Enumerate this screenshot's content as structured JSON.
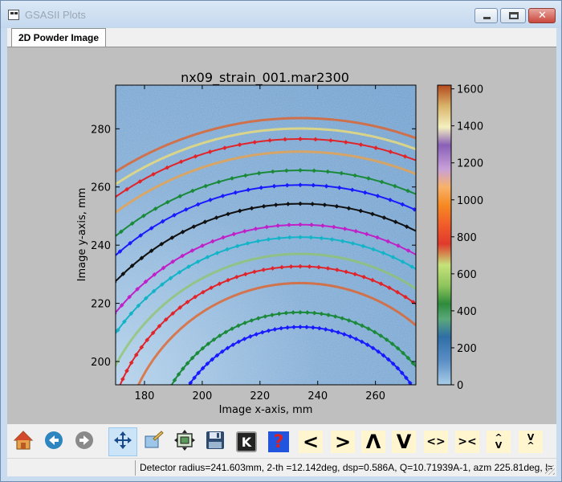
{
  "window": {
    "title": "GSASII Plots",
    "close_glyph": "✕"
  },
  "tabs": [
    {
      "label": "2D Powder Image",
      "active": true
    }
  ],
  "plot": {
    "title": "nx09_strain_001.mar2300",
    "xlabel": "Image x-axis, mm",
    "ylabel": "Image y-axis, mm",
    "xlim": [
      170,
      274
    ],
    "ylim": [
      192,
      295
    ],
    "x_ticks": [
      "180",
      "200",
      "220",
      "240",
      "260"
    ],
    "y_ticks": [
      "200",
      "220",
      "240",
      "260",
      "280"
    ],
    "colorbar": {
      "range": [
        0,
        1620
      ],
      "ticks": [
        "0",
        "200",
        "400",
        "600",
        "800",
        "1000",
        "1200",
        "1400",
        "1600"
      ]
    },
    "center": [
      145,
      157
    ],
    "rings": [
      {
        "r": 65,
        "color": "#1a1aff",
        "markers": true
      },
      {
        "r": 72,
        "color": "#1a8a3a",
        "markers": true
      },
      {
        "r": 86,
        "color": "#e65c1e",
        "markers": false
      },
      {
        "r": 94,
        "color": "#e0242a",
        "markers": true
      },
      {
        "r": 100,
        "color": "#8fc46a",
        "markers": false
      },
      {
        "r": 108,
        "color": "#14b4c8",
        "markers": true
      },
      {
        "r": 114,
        "color": "#c020c8",
        "markers": true
      },
      {
        "r": 124,
        "color": "#111111",
        "markers": true
      },
      {
        "r": 133,
        "color": "#1a1aff",
        "markers": true
      },
      {
        "r": 140,
        "color": "#1a8a3a",
        "markers": true
      },
      {
        "r": 149,
        "color": "#f0a040",
        "markers": false
      },
      {
        "r": 155,
        "color": "#e0242a",
        "markers": true
      },
      {
        "r": 160,
        "color": "#f4e070",
        "markers": false
      },
      {
        "r": 165,
        "color": "#e65c1e",
        "markers": false
      }
    ]
  },
  "toolbar": [
    {
      "name": "home-button",
      "icon": "home-icon"
    },
    {
      "name": "back-button",
      "icon": "back-arrow-icon"
    },
    {
      "name": "forward-button",
      "icon": "forward-arrow-icon"
    },
    {
      "name": "pan-button",
      "icon": "pan-arrows-icon",
      "active": true
    },
    {
      "name": "zoom-button",
      "icon": "zoom-icon"
    },
    {
      "name": "configure-subplots-button",
      "icon": "subplots-icon"
    },
    {
      "name": "save-button",
      "icon": "floppy-disk-icon"
    },
    {
      "name": "key-button",
      "icon": "key-k-icon",
      "glyph": "K"
    },
    {
      "name": "help-button",
      "icon": "help-question-icon",
      "glyph": "?"
    },
    {
      "name": "shift-left-button",
      "glyph": "<"
    },
    {
      "name": "shift-right-button",
      "glyph": ">"
    },
    {
      "name": "shift-up-button",
      "glyph": "Λ"
    },
    {
      "name": "shift-down-button",
      "glyph": "V"
    },
    {
      "name": "expand-horizontal-button",
      "glyph": "<>"
    },
    {
      "name": "shrink-horizontal-button",
      "glyph": "><"
    },
    {
      "name": "expand-vertical-button",
      "glyph": "^\nV"
    },
    {
      "name": "shrink-vertical-button",
      "glyph": "V\n^"
    }
  ],
  "status": {
    "text": "Detector radius=241.603mm, 2-th =12.142deg, dsp=0.586A, Q=10.71939A-1, azm 225.81deg, I="
  }
}
